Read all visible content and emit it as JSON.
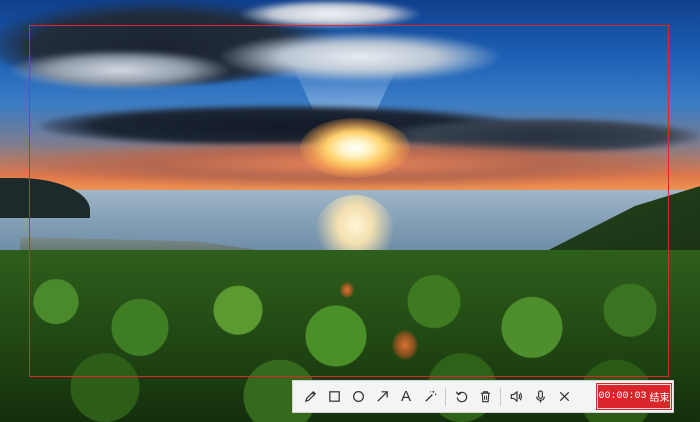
{
  "background": {
    "description_icon": "landscape-photo"
  },
  "capture_frame": {
    "color": "#e0262b"
  },
  "toolbar": {
    "tools": [
      {
        "id": "pen",
        "icon": "pencil-icon"
      },
      {
        "id": "rectangle",
        "icon": "square-icon"
      },
      {
        "id": "ellipse",
        "icon": "circle-icon"
      },
      {
        "id": "arrow",
        "icon": "arrow-icon"
      },
      {
        "id": "text",
        "icon": "text-icon",
        "glyph": "A"
      },
      {
        "id": "magic",
        "icon": "magic-wand-icon"
      },
      {
        "id": "undo",
        "icon": "undo-icon"
      },
      {
        "id": "delete",
        "icon": "trash-icon"
      },
      {
        "id": "speaker",
        "icon": "speaker-icon"
      },
      {
        "id": "microphone",
        "icon": "microphone-icon"
      },
      {
        "id": "close",
        "icon": "close-icon"
      }
    ],
    "recording": {
      "timer": "00:00:03",
      "end_label": "结束",
      "accent": "#d8262b"
    }
  }
}
